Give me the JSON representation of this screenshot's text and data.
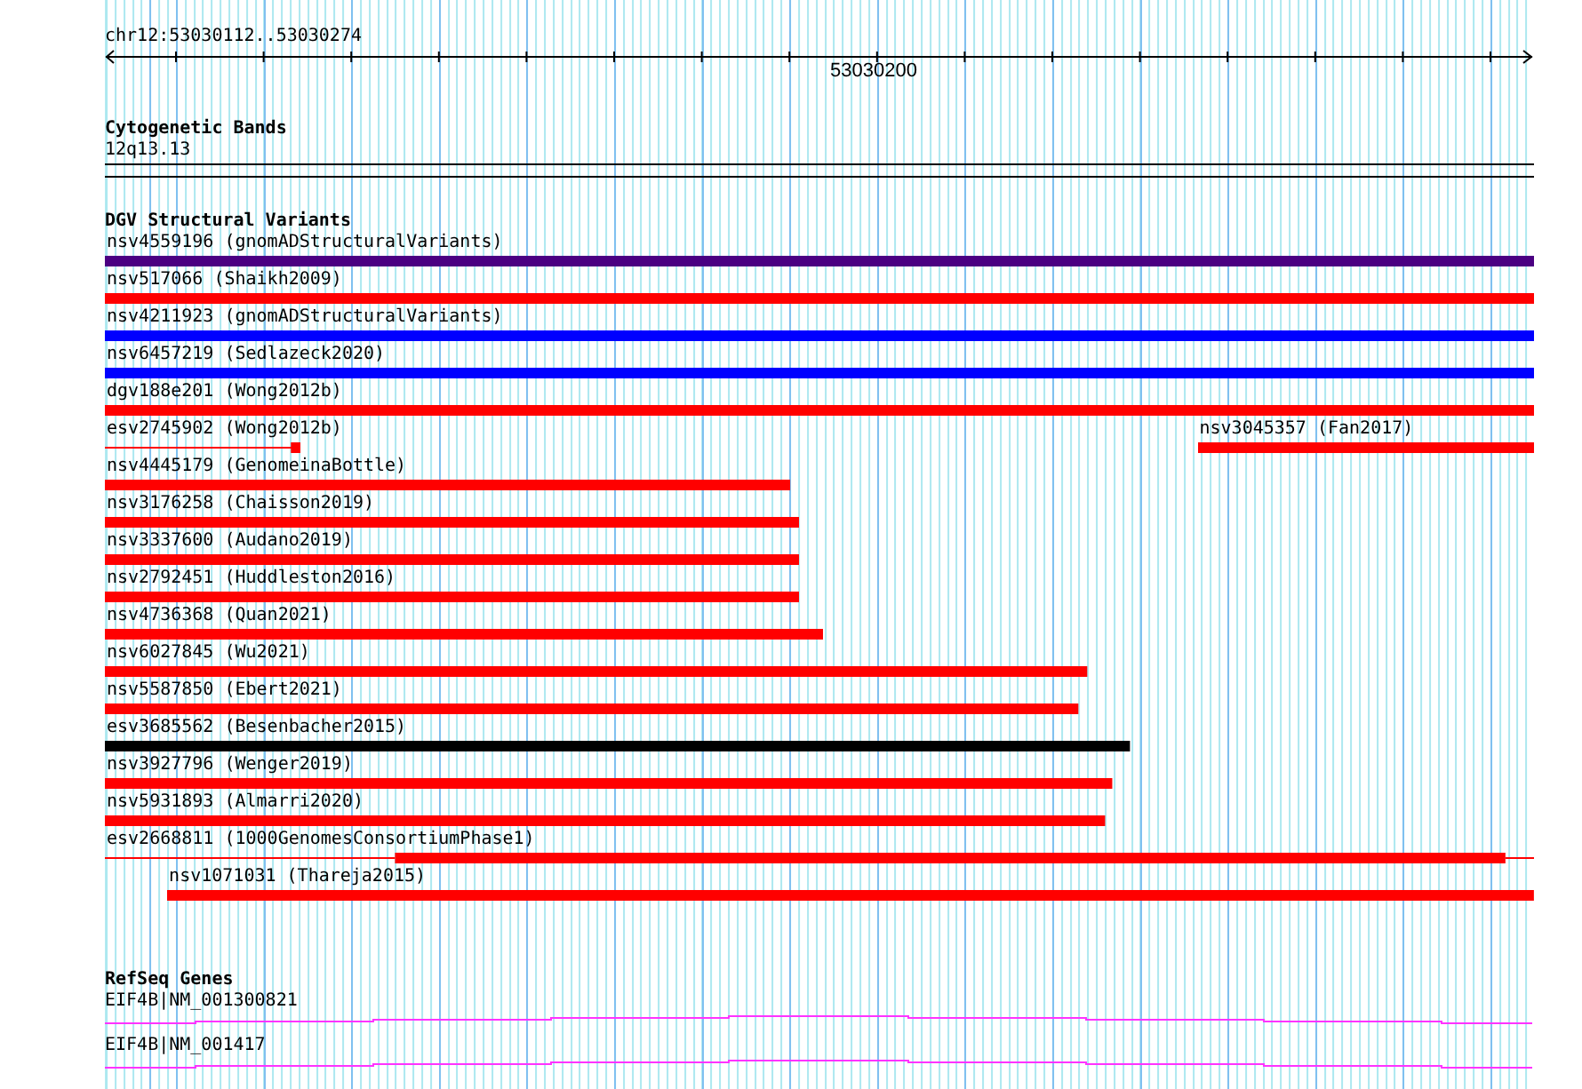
{
  "ruler": {
    "location": "chr12:53030112..53030274",
    "tick_label": "53030200"
  },
  "tracks": [
    {
      "kind": "cytoband",
      "title": "Cytogenetic Bands",
      "band": "12q13.13"
    },
    {
      "kind": "variants",
      "title": "DGV Structural Variants",
      "rows": [
        {
          "features": [
            {
              "label": "nsv4559196 (gnomADStructuralVariants)",
              "color": "#4b0082"
            }
          ]
        },
        {
          "features": [
            {
              "label": "nsv517066 (Shaikh2009)",
              "color": "#ff0000"
            }
          ]
        },
        {
          "features": [
            {
              "label": "nsv4211923 (gnomADStructuralVariants)",
              "color": "#0000ff"
            }
          ]
        },
        {
          "features": [
            {
              "label": "nsv6457219 (Sedlazeck2020)",
              "color": "#0000ff"
            }
          ]
        },
        {
          "features": [
            {
              "label": "dgv188e201 (Wong2012b)",
              "color": "#ff0000"
            }
          ]
        },
        {
          "features": [
            {
              "label": "esv2745902 (Wong2012b)",
              "color": "#ff0000"
            },
            {
              "label": "nsv3045357 (Fan2017)",
              "color": "#ff0000"
            }
          ]
        },
        {
          "features": [
            {
              "label": "nsv4445179 (GenomeinaBottle)",
              "color": "#ff0000"
            }
          ]
        },
        {
          "features": [
            {
              "label": "nsv3176258 (Chaisson2019)",
              "color": "#ff0000"
            }
          ]
        },
        {
          "features": [
            {
              "label": "nsv3337600 (Audano2019)",
              "color": "#ff0000"
            }
          ]
        },
        {
          "features": [
            {
              "label": "nsv2792451 (Huddleston2016)",
              "color": "#ff0000"
            }
          ]
        },
        {
          "features": [
            {
              "label": "nsv4736368 (Quan2021)",
              "color": "#ff0000"
            }
          ]
        },
        {
          "features": [
            {
              "label": "nsv6027845 (Wu2021)",
              "color": "#ff0000"
            }
          ]
        },
        {
          "features": [
            {
              "label": "nsv5587850 (Ebert2021)",
              "color": "#ff0000"
            }
          ]
        },
        {
          "features": [
            {
              "label": "esv3685562 (Besenbacher2015)",
              "color": "#000000"
            }
          ]
        },
        {
          "features": [
            {
              "label": "nsv3927796 (Wenger2019)",
              "color": "#ff0000"
            }
          ]
        },
        {
          "features": [
            {
              "label": "nsv5931893 (Almarri2020)",
              "color": "#ff0000"
            }
          ]
        },
        {
          "features": [
            {
              "label": "esv2668811 (1000GenomesConsortiumPhase1)",
              "color": "#ff0000"
            }
          ]
        },
        {
          "features": [
            {
              "label": "nsv1071031 (Thareja2015)",
              "color": "#ff0000"
            }
          ]
        }
      ]
    },
    {
      "kind": "genes",
      "title": "RefSeq Genes",
      "transcripts": [
        {
          "label": "EIF4B|NM_001300821"
        },
        {
          "label": "EIF4B|NM_001417"
        }
      ]
    }
  ]
}
